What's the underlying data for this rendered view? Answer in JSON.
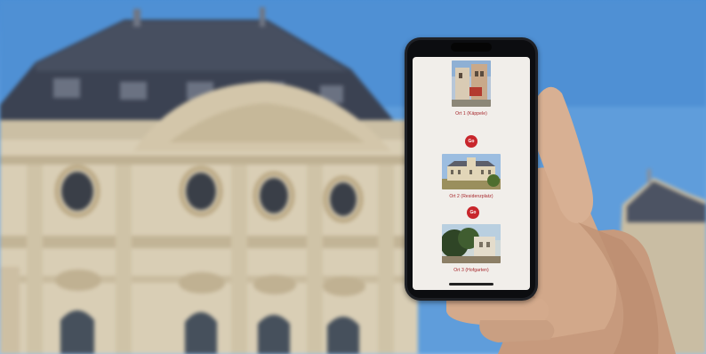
{
  "scene": {
    "description_colors": {
      "sky": "#5b9ad9",
      "facade": "#d8ccb3",
      "roof": "#3d4556",
      "phone_frame": "#1f2126",
      "screen_bg": "#f1eeea",
      "accent_red": "#c8262c"
    }
  },
  "app": {
    "stations": [
      {
        "label": "Ort 1 (Käppele)",
        "icon": "street-photo"
      },
      {
        "label": "Ort 2 (Residenzplatz)",
        "icon": "palace-photo"
      },
      {
        "label": "Ort 3 (Hofgarten)",
        "icon": "garden-photo"
      }
    ],
    "connectors": [
      {
        "label": "Go"
      },
      {
        "label": "Go"
      }
    ]
  }
}
